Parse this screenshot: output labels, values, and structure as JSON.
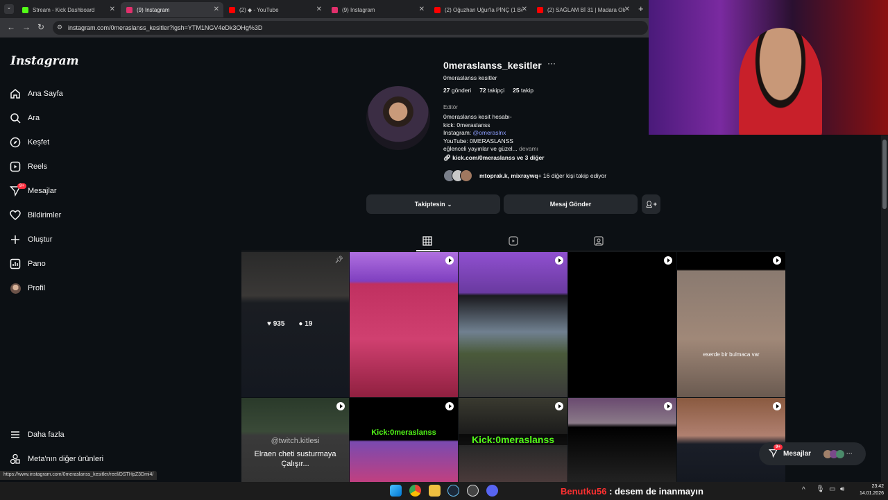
{
  "browser": {
    "tabs": [
      {
        "title": "Stream - Kick Dashboard",
        "favicon_color": "#53fc18"
      },
      {
        "title": "(9) Instagram",
        "favicon_color": "#e1306c"
      },
      {
        "title": "(2) ◆ - YouTube",
        "favicon_color": "#ff0000"
      },
      {
        "title": "(9) Instagram",
        "favicon_color": "#e1306c"
      },
      {
        "title": "(2) Oğuzhan Uğur'la PİNÇ (1 Bö",
        "favicon_color": "#ff0000"
      },
      {
        "title": "(2) SAĞLAM Bİ 31 | Madara Old",
        "favicon_color": "#ff0000"
      }
    ],
    "url": "instagram.com/0meraslanss_kesitler?igsh=YTM1NGV4eDk3OHg%3D",
    "status_url": "https://www.instagram.com/0meraslanss_kesitler/reel/DSTHpZ3Dmi4/"
  },
  "sidebar": {
    "logo": "Instagram",
    "items": [
      {
        "label": "Ana Sayfa",
        "icon": "home-icon"
      },
      {
        "label": "Ara",
        "icon": "search-icon"
      },
      {
        "label": "Keşfet",
        "icon": "explore-icon"
      },
      {
        "label": "Reels",
        "icon": "reels-icon"
      },
      {
        "label": "Mesajlar",
        "icon": "messages-icon",
        "badge": "9+"
      },
      {
        "label": "Bildirimler",
        "icon": "heart-icon"
      },
      {
        "label": "Oluştur",
        "icon": "plus-icon"
      },
      {
        "label": "Pano",
        "icon": "dashboard-icon"
      },
      {
        "label": "Profil",
        "icon": "profile-avatar"
      }
    ],
    "more": "Daha fazla",
    "meta": "Meta'nın diğer ürünleri"
  },
  "profile": {
    "username": "0meraslanss_kesitler",
    "full_name": "0meraslanss kesitler",
    "posts_count": "27",
    "posts_label": "gönderi",
    "followers_count": "72",
    "followers_label": "takipçi",
    "following_count": "25",
    "following_label": "takip",
    "category": "Editör",
    "bio": {
      "line1": "0meraslanss kesit hesabı-",
      "line2": "kick: 0meraslanss",
      "line3_prefix": "Instagram: ",
      "line3_mention": "@omeraslnx",
      "line4": "YouTube: 0MERASLANSS",
      "line5": "eğlenceli yayınlar ve güzel...",
      "more": "devamı"
    },
    "link": "kick.com/0meraslanss ve 3 diğer",
    "followed_by_names": "mtoprak.k, mixraywq",
    "followed_by_rest": " + 16 diğer kişi takip ediyor",
    "follow_button": "Takiptesin",
    "message_button": "Mesaj Gönder"
  },
  "grid": {
    "likes": "935",
    "comments": "19",
    "captions": {
      "bulmaca": "eserde bir bulmaca var",
      "kick1": "Kick:0meraslanss",
      "kick2": "Kick:0meraslanss",
      "twitch": "@twitch.kitlesi",
      "elraen": "Elraen cheti susturmaya Çalışır..."
    }
  },
  "floating_messages": {
    "label": "Mesajlar",
    "badge": "9+"
  },
  "stream_chat": {
    "nick": "Benutku56",
    "message": " : desem de inanmayın"
  },
  "taskbar": {
    "time": "23:42",
    "date": "14.01.2026"
  }
}
